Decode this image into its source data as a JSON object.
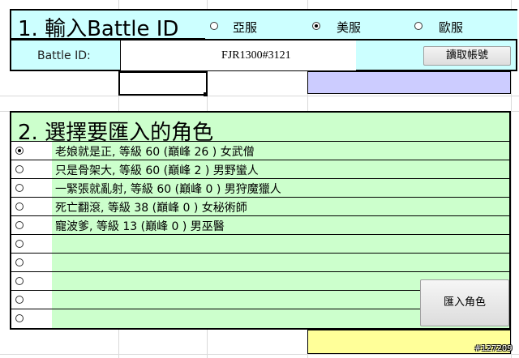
{
  "section1": {
    "title": "1. 輸入Battle ID",
    "regions": [
      {
        "label": "亞服",
        "selected": false
      },
      {
        "label": "美服",
        "selected": true
      },
      {
        "label": "歐服",
        "selected": false
      }
    ],
    "battle_id_label": "Battle ID:",
    "battle_id_value": "FJR1300#3121",
    "read_button_label": "讀取帳號"
  },
  "section2": {
    "title": "2. 選擇要匯入的角色",
    "characters": [
      {
        "label": "老娘就是正, 等級 60 (巔峰 26 ) 女武僧",
        "selected": true
      },
      {
        "label": "只是骨架大, 等級 60 (巔峰 2 ) 男野蠻人",
        "selected": false
      },
      {
        "label": "一緊張就亂射, 等級 60 (巔峰 0 ) 男狩魔獵人",
        "selected": false
      },
      {
        "label": "死亡翻滾, 等級 38 (巔峰 0 ) 女秘術師",
        "selected": false
      },
      {
        "label": "寵波爹, 等級 13 (巔峰 0 ) 男巫醫",
        "selected": false
      },
      {
        "label": "",
        "selected": false
      },
      {
        "label": "",
        "selected": false
      },
      {
        "label": "",
        "selected": false
      },
      {
        "label": "",
        "selected": false
      },
      {
        "label": "",
        "selected": false
      }
    ],
    "import_button_label": "匯入角色"
  },
  "colors": {
    "section1_bg": "#ccffff",
    "section2_bg": "#ccffcc",
    "purple_cell": "#ccccff",
    "yellow_cell": "#ffff99"
  },
  "watermark": "#127209"
}
